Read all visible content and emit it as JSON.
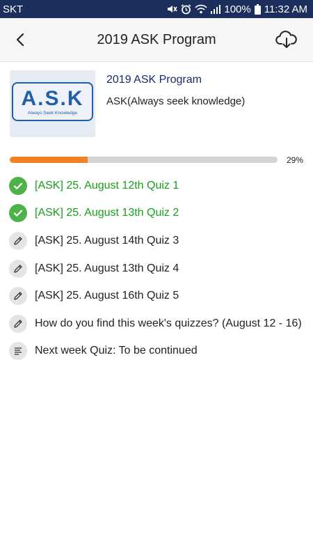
{
  "status_bar": {
    "carrier": "SKT",
    "battery": "100%",
    "time": "11:32 AM",
    "icons": [
      "mute-icon",
      "alarm-icon",
      "wifi-icon",
      "signal-icon",
      "battery-icon"
    ]
  },
  "app_bar": {
    "title": "2019 ASK Program",
    "back_icon": "chevron-left-icon",
    "download_icon": "cloud-download-icon"
  },
  "program": {
    "logo_text": "A.S.K",
    "logo_subtitle": "Always Seek Knowledge",
    "title": "2019 ASK Program",
    "description": "ASK(Always seek knowledge)"
  },
  "progress": {
    "value": 0.29,
    "label": "29%",
    "fill_color": "#f48024"
  },
  "items": [
    {
      "label": "[ASK] 25. August 12th Quiz 1",
      "status": "done",
      "icon": "check-icon"
    },
    {
      "label": "[ASK] 25. August 13th Quiz 2",
      "status": "done",
      "icon": "check-icon"
    },
    {
      "label": "[ASK] 25. August 14th Quiz 3",
      "status": "todo",
      "icon": "pencil-icon"
    },
    {
      "label": "[ASK] 25. August 13th Quiz 4",
      "status": "todo",
      "icon": "pencil-icon"
    },
    {
      "label": "[ASK] 25. August 16th Quiz 5",
      "status": "todo",
      "icon": "pencil-icon"
    },
    {
      "label": "How do you find this week's quizzes? (August 12 - 16)",
      "status": "todo",
      "icon": "pencil-icon"
    },
    {
      "label": "Next week Quiz: To be continued",
      "status": "todo",
      "icon": "notes-icon"
    }
  ],
  "colors": {
    "status_bar": "#1c2f5c",
    "done_text": "#17a01c",
    "done_icon_bg": "#4bb348",
    "program_title": "#162b6b"
  }
}
